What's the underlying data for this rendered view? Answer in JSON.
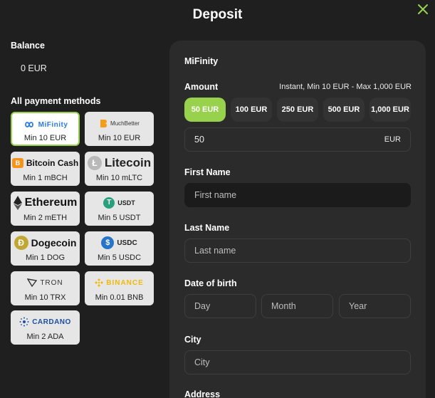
{
  "title": "Deposit",
  "balance": {
    "label": "Balance",
    "value": "0 EUR"
  },
  "methods_label": "All payment methods",
  "methods": [
    {
      "name": "MiFinity",
      "min": "Min 10 EUR"
    },
    {
      "name": "MuchBetter",
      "min": "Min 10 EUR"
    },
    {
      "name": "Bitcoin Cash",
      "min": "Min 1 mBCH"
    },
    {
      "name": "Litecoin",
      "min": "Min 10 mLTC"
    },
    {
      "name": "Ethereum",
      "min": "Min 2 mETH"
    },
    {
      "name": "USDT",
      "min": "Min 5 USDT"
    },
    {
      "name": "Dogecoin",
      "min": "Min 1 DOG"
    },
    {
      "name": "USDC",
      "min": "Min 5 USDC"
    },
    {
      "name": "TRON",
      "min": "Min 10 TRX"
    },
    {
      "name": "BINANCE",
      "min": "Min 0.01 BNB"
    },
    {
      "name": "CARDANO",
      "min": "Min 2 ADA"
    }
  ],
  "form": {
    "method_title": "MiFinity",
    "amount_label": "Amount",
    "amount_info": "Instant, Min 10 EUR - Max 1,000 EUR",
    "presets": [
      "50 EUR",
      "100 EUR",
      "250 EUR",
      "500 EUR",
      "1,000 EUR"
    ],
    "amount_value": "50",
    "currency": "EUR",
    "first_name_label": "First Name",
    "first_name_placeholder": "First name",
    "last_name_label": "Last Name",
    "last_name_placeholder": "Last name",
    "dob_label": "Date of birth",
    "dob_day": "Day",
    "dob_month": "Month",
    "dob_year": "Year",
    "city_label": "City",
    "city_placeholder": "City",
    "address_label": "Address"
  },
  "colors": {
    "accent": "#98d24d",
    "background": "#1f1f1f",
    "panel": "#2b2b2b"
  }
}
